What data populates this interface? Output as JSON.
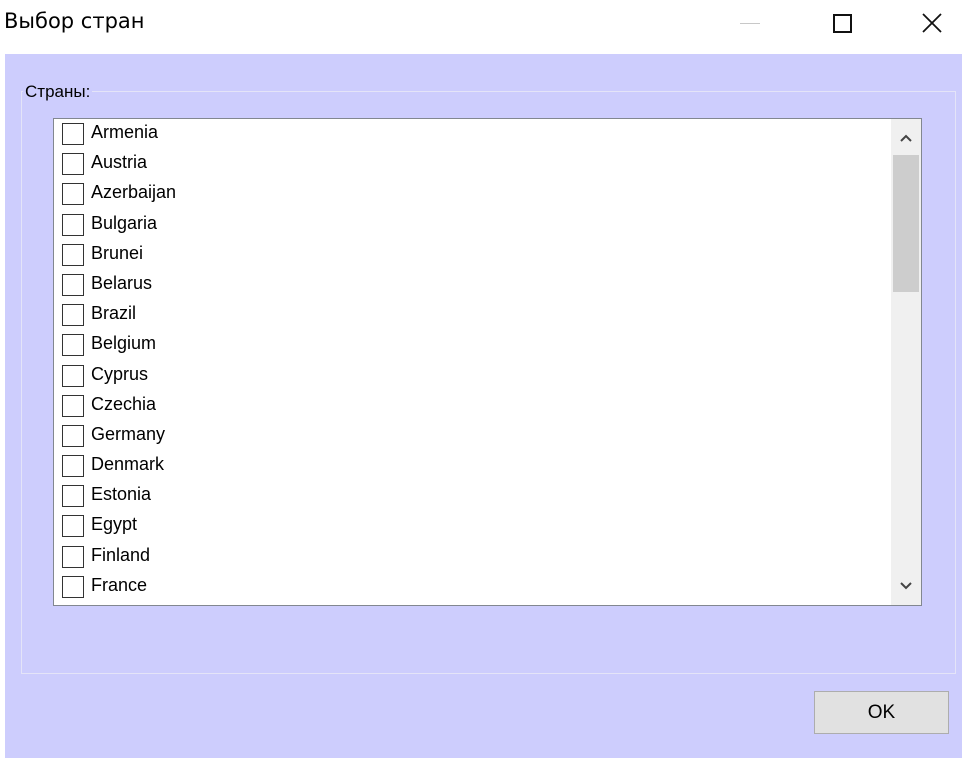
{
  "window": {
    "title": "Выбор стран",
    "controls": [
      "minimize-icon",
      "maximize-icon",
      "close-icon"
    ]
  },
  "group": {
    "label": "Страны:"
  },
  "countries": [
    {
      "label": "Armenia",
      "checked": false
    },
    {
      "label": "Austria",
      "checked": false
    },
    {
      "label": "Azerbaijan",
      "checked": false
    },
    {
      "label": "Bulgaria",
      "checked": false
    },
    {
      "label": "Brunei",
      "checked": false
    },
    {
      "label": "Belarus",
      "checked": false
    },
    {
      "label": "Brazil",
      "checked": false
    },
    {
      "label": "Belgium",
      "checked": false
    },
    {
      "label": "Cyprus",
      "checked": false
    },
    {
      "label": "Czechia",
      "checked": false
    },
    {
      "label": "Germany",
      "checked": false
    },
    {
      "label": "Denmark",
      "checked": false
    },
    {
      "label": "Estonia",
      "checked": false
    },
    {
      "label": "Egypt",
      "checked": false
    },
    {
      "label": "Finland",
      "checked": false
    },
    {
      "label": "France",
      "checked": false
    }
  ],
  "buttons": {
    "ok_label": "OK"
  },
  "colors": {
    "dialog_background": "#cdcdfd",
    "list_background": "#ffffff",
    "button_background": "#e1e1e1"
  }
}
